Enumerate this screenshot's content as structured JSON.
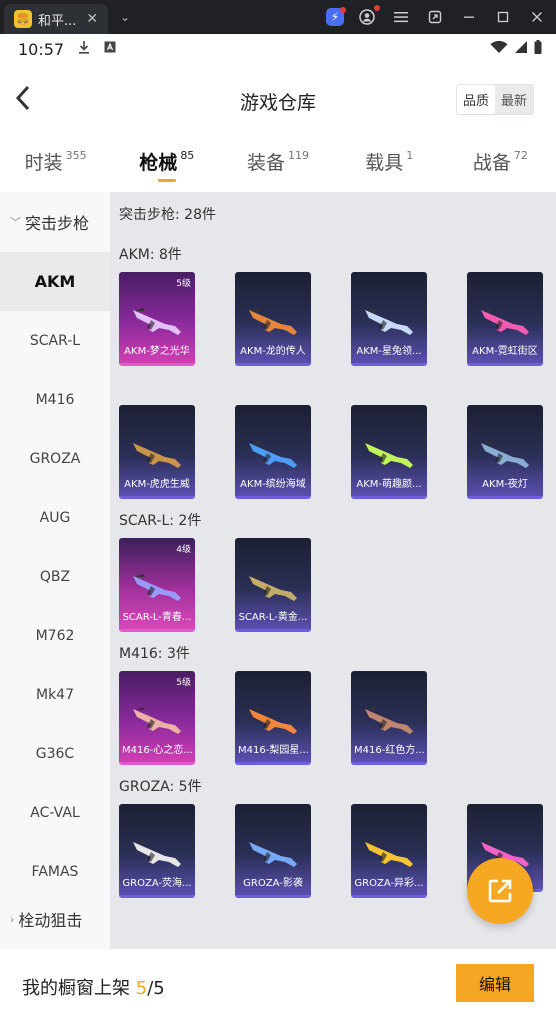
{
  "window": {
    "app_title": "和平...",
    "tab_close": "✕",
    "tab_menu": "⌄"
  },
  "statusbar": {
    "time": "10:57"
  },
  "header": {
    "title": "游戏仓库",
    "sort_quality": "品质",
    "sort_newest": "最新"
  },
  "categories": [
    {
      "label": "时装",
      "count": "355"
    },
    {
      "label": "枪械",
      "count": "85"
    },
    {
      "label": "装备",
      "count": "119"
    },
    {
      "label": "载具",
      "count": "1"
    },
    {
      "label": "战备",
      "count": "72"
    }
  ],
  "active_category": 1,
  "sidebar": {
    "group_label": "突击步枪",
    "items": [
      "AKM",
      "SCAR-L",
      "M416",
      "GROZA",
      "AUG",
      "QBZ",
      "M762",
      "Mk47",
      "G36C",
      "AC-VAL",
      "FAMAS"
    ],
    "active_item": "AKM",
    "bottom_group_label": "栓动狙击"
  },
  "content": {
    "summary": "突击步枪: 28件",
    "sections": [
      {
        "title": "AKM: 8件",
        "items": [
          {
            "name": "AKM-梦之光华",
            "level": "5级",
            "style": "pink"
          },
          {
            "name": "AKM-龙的传人",
            "style": "dark"
          },
          {
            "name": "AKM-星兔领...",
            "style": "dark"
          },
          {
            "name": "AKM-霓虹街区",
            "style": "dark"
          },
          {
            "name": "AKM-虎虎生威",
            "style": "dark"
          },
          {
            "name": "AKM-缤纷海域",
            "style": "dark"
          },
          {
            "name": "AKM-萌趣颜...",
            "style": "dark"
          },
          {
            "name": "AKM-夜灯",
            "style": "dark"
          }
        ]
      },
      {
        "title": "SCAR-L: 2件",
        "items": [
          {
            "name": "SCAR-L-青春...",
            "level": "4级",
            "style": "pink2"
          },
          {
            "name": "SCAR-L-黄金...",
            "style": "dark"
          }
        ]
      },
      {
        "title": "M416: 3件",
        "items": [
          {
            "name": "M416-心之恋...",
            "level": "5级",
            "style": "pink"
          },
          {
            "name": "M416-梨园星...",
            "style": "dark"
          },
          {
            "name": "M416-红色方...",
            "style": "dark"
          }
        ]
      },
      {
        "title": "GROZA: 5件",
        "items": [
          {
            "name": "GROZA-荧海...",
            "style": "dark"
          },
          {
            "name": "GROZA-影袭",
            "style": "dark"
          },
          {
            "name": "GROZA-异彩...",
            "style": "dark"
          },
          {
            "name": "",
            "style": "dark"
          }
        ]
      }
    ]
  },
  "footer": {
    "label": "我的橱窗上架",
    "current": "5",
    "separator": "/",
    "total": "5",
    "edit_label": "编辑"
  },
  "colors": {
    "accent": "#f5a623",
    "card_dark": "#2a2f55",
    "card_pink": "#cf3fb2"
  }
}
